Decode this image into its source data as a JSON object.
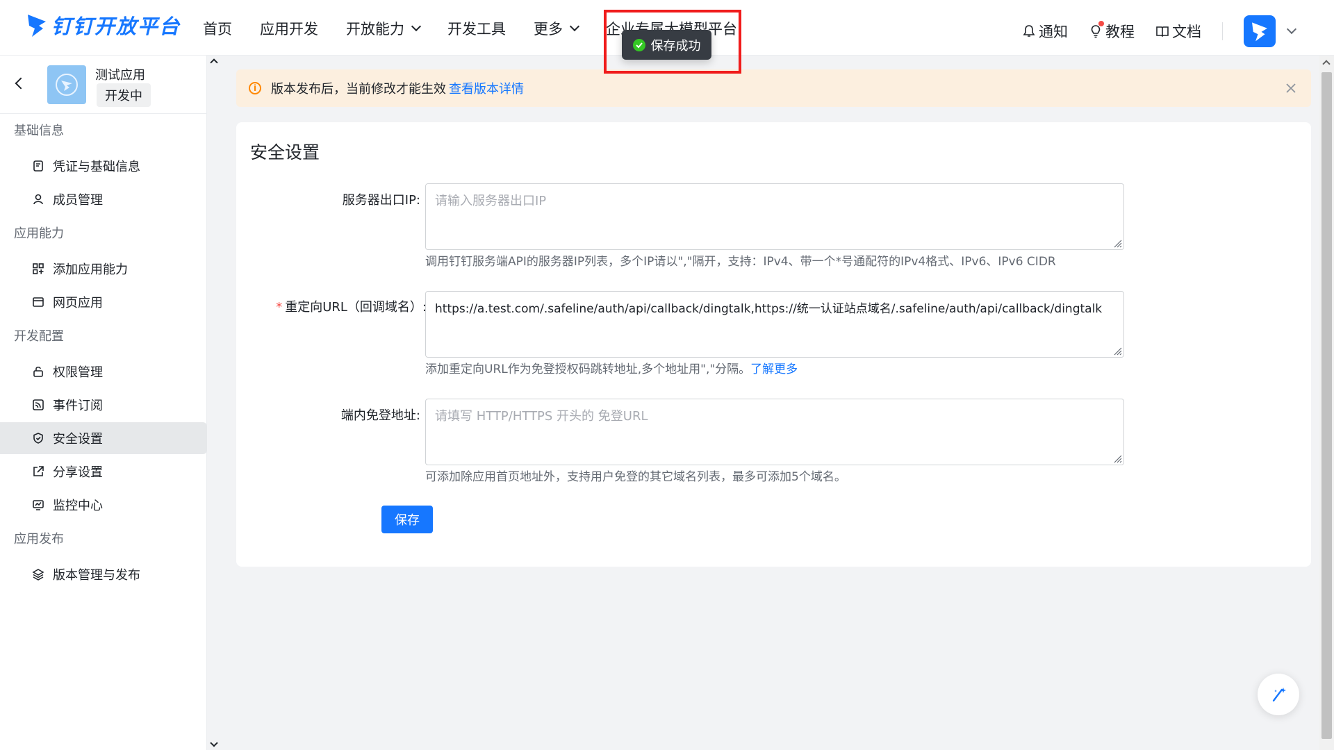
{
  "brand": {
    "name": "钉钉开放平台"
  },
  "nav": {
    "items": [
      {
        "label": "首页",
        "dropdown": false
      },
      {
        "label": "应用开发",
        "dropdown": false
      },
      {
        "label": "开放能力",
        "dropdown": true
      },
      {
        "label": "开发工具",
        "dropdown": false
      },
      {
        "label": "更多",
        "dropdown": true
      },
      {
        "label": "企业专属大模型平台",
        "dropdown": false
      }
    ],
    "right": {
      "notify": "通知",
      "tutorial": "教程",
      "docs": "文档"
    }
  },
  "toast": {
    "text": "保存成功",
    "status_color": "#34c724"
  },
  "sidebar": {
    "app_name": "测试应用",
    "app_status": "开发中",
    "groups": [
      {
        "title": "基础信息",
        "items": [
          {
            "label": "凭证与基础信息",
            "icon": "credential-icon"
          },
          {
            "label": "成员管理",
            "icon": "user-icon"
          }
        ]
      },
      {
        "title": "应用能力",
        "items": [
          {
            "label": "添加应用能力",
            "icon": "apps-add-icon"
          },
          {
            "label": "网页应用",
            "icon": "webpage-icon"
          }
        ]
      },
      {
        "title": "开发配置",
        "items": [
          {
            "label": "权限管理",
            "icon": "permission-icon"
          },
          {
            "label": "事件订阅",
            "icon": "rss-icon"
          },
          {
            "label": "安全设置",
            "icon": "shield-icon",
            "active": true
          },
          {
            "label": "分享设置",
            "icon": "share-icon"
          },
          {
            "label": "监控中心",
            "icon": "monitor-icon"
          }
        ]
      },
      {
        "title": "应用发布",
        "items": [
          {
            "label": "版本管理与发布",
            "icon": "layers-icon"
          }
        ]
      }
    ]
  },
  "alert": {
    "text": "版本发布后，当前修改才能生效",
    "link": "查看版本详情"
  },
  "security": {
    "title": "安全设置",
    "server_ip": {
      "label": "服务器出口IP:",
      "placeholder": "请输入服务器出口IP",
      "value": "",
      "helper": "调用钉钉服务端API的服务器IP列表，多个IP请以\",\"隔开，支持：IPv4、带一个*号通配符的IPv4格式、IPv6、IPv6 CIDR"
    },
    "redirect_url": {
      "label": "重定向URL（回调域名）:",
      "required_mark": "*",
      "value": "https://a.test.com/.safeline/auth/api/callback/dingtalk,https://统一认证站点域名/.safeline/auth/api/callback/dingtalk",
      "helper": "添加重定向URL作为免登授权码跳转地址,多个地址用\",\"分隔。",
      "helper_link": "了解更多"
    },
    "sso_url": {
      "label": "端内免登地址:",
      "placeholder": "请填写 HTTP/HTTPS 开头的 免登URL",
      "value": "",
      "helper": "可添加除应用首页地址外，支持用户免登的其它域名列表，最多可添加5个域名。"
    },
    "save_label": "保存"
  },
  "colors": {
    "accent": "#1677ff",
    "warning": "#ff8800",
    "highlight": "#f01c1c"
  }
}
